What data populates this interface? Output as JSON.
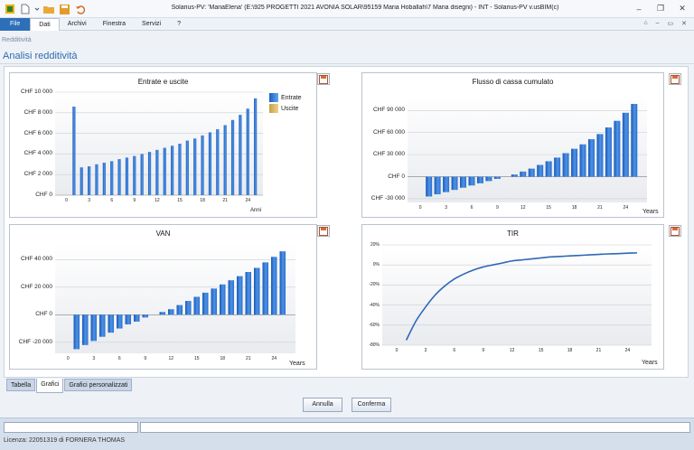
{
  "window": {
    "title": "Solarius-PV: 'MariaElena' (E:\\925 PROGETTI 2021 AVONIA SOLAR\\95159 Maria Hoballah\\7 Maria disegni) - INT - Solarius-PV  v.usBIM(c)"
  },
  "menu": {
    "items": [
      "File",
      "Dati",
      "Archivi",
      "Finestra",
      "Servizi",
      "?"
    ]
  },
  "breadcrumb": "Redditività",
  "page_title": "Analisi redditività",
  "charts": {
    "entrate": {
      "title": "Entrate e uscite",
      "ylabels": [
        "CHF 10 000",
        "CHF 8 000",
        "CHF 6 000",
        "CHF 4 000",
        "CHF 2 000",
        "CHF 0"
      ],
      "xlabels": [
        "0",
        "3",
        "6",
        "9",
        "12",
        "15",
        "18",
        "21",
        "24"
      ],
      "xaxis": "Anni",
      "legend": [
        "Entrate",
        "Uscite"
      ]
    },
    "flusso": {
      "title": "Flusso di cassa cumulato",
      "ylabels": [
        "CHF 90 000",
        "CHF 60 000",
        "CHF 30 000",
        "CHF 0",
        "CHF -30 000"
      ],
      "xlabels": [
        "0",
        "3",
        "6",
        "9",
        "12",
        "15",
        "18",
        "21",
        "24"
      ],
      "xaxis": "Years"
    },
    "van": {
      "title": "VAN",
      "ylabels": [
        "CHF 40 000",
        "CHF 20 000",
        "CHF 0",
        "CHF -20 000"
      ],
      "xlabels": [
        "0",
        "3",
        "6",
        "9",
        "12",
        "15",
        "18",
        "21",
        "24"
      ],
      "xaxis": "Years"
    },
    "tir": {
      "title": "TIR",
      "ylabels": [
        "20%",
        "0%",
        "-20%",
        "-40%",
        "-60%",
        "-80%"
      ],
      "xlabels": [
        "0",
        "3",
        "6",
        "9",
        "12",
        "15",
        "18",
        "21",
        "24"
      ],
      "xaxis": "Years"
    }
  },
  "tabs": [
    "Tabella",
    "Grafici",
    "Grafici personalizzati"
  ],
  "buttons": {
    "annulla": "Annulla",
    "conferma": "Conferma"
  },
  "status": {
    "license": "Licenza: 22051319 di FORNERA THOMAS"
  },
  "colors": {
    "accent": "#2c6cb0",
    "bar": "#2f74d0",
    "uscite": "#d9b45a"
  },
  "chart_data": [
    {
      "type": "bar",
      "title": "Entrate e uscite",
      "xlabel": "Anni",
      "ylabel": "",
      "ylim": [
        0,
        10000
      ],
      "x": [
        1,
        2,
        3,
        4,
        5,
        6,
        7,
        8,
        9,
        10,
        11,
        12,
        13,
        14,
        15,
        16,
        17,
        18,
        19,
        20,
        21,
        22,
        23,
        24,
        25
      ],
      "series": [
        {
          "name": "Entrate",
          "values": [
            8600,
            2700,
            2800,
            3000,
            3150,
            3300,
            3500,
            3650,
            3800,
            4000,
            4200,
            4400,
            4600,
            4800,
            5000,
            5300,
            5500,
            5800,
            6100,
            6400,
            6800,
            7300,
            7800,
            8400,
            9400
          ]
        },
        {
          "name": "Uscite",
          "values": [
            0,
            0,
            0,
            0,
            0,
            0,
            0,
            0,
            0,
            0,
            0,
            0,
            0,
            0,
            0,
            0,
            0,
            0,
            0,
            0,
            0,
            0,
            0,
            0,
            0
          ]
        }
      ],
      "legend_position": "right"
    },
    {
      "type": "bar",
      "title": "Flusso di cassa cumulato",
      "xlabel": "Years",
      "ylabel": "",
      "ylim": [
        -30000,
        110000
      ],
      "x": [
        1,
        2,
        3,
        4,
        5,
        6,
        7,
        8,
        9,
        10,
        11,
        12,
        13,
        14,
        15,
        16,
        17,
        18,
        19,
        20,
        21,
        22,
        23,
        24,
        25
      ],
      "series": [
        {
          "values": [
            -27000,
            -24000,
            -21000,
            -18000,
            -15000,
            -12000,
            -9000,
            -6000,
            -3000,
            0,
            3000,
            7000,
            11000,
            16000,
            21000,
            26000,
            32000,
            38000,
            44000,
            51000,
            58000,
            67000,
            76000,
            87000,
            99000
          ]
        }
      ]
    },
    {
      "type": "bar",
      "title": "VAN",
      "xlabel": "Years",
      "ylabel": "",
      "ylim": [
        -30000,
        50000
      ],
      "x": [
        1,
        2,
        3,
        4,
        5,
        6,
        7,
        8,
        9,
        10,
        11,
        12,
        13,
        14,
        15,
        16,
        17,
        18,
        19,
        20,
        21,
        22,
        23,
        24,
        25
      ],
      "series": [
        {
          "values": [
            -25000,
            -22000,
            -19000,
            -16000,
            -13000,
            -10000,
            -7000,
            -5000,
            -2000,
            0,
            2000,
            4000,
            7000,
            10000,
            13000,
            16000,
            19000,
            22000,
            25000,
            28000,
            31000,
            34000,
            38000,
            42000,
            46000
          ]
        }
      ]
    },
    {
      "type": "line",
      "title": "TIR",
      "xlabel": "Years",
      "ylabel": "",
      "ylim": [
        -80,
        20
      ],
      "x": [
        1,
        2,
        3,
        4,
        5,
        6,
        7,
        8,
        9,
        10,
        11,
        12,
        13,
        14,
        15,
        16,
        17,
        18,
        19,
        20,
        21,
        22,
        23,
        24,
        25
      ],
      "series": [
        {
          "values": [
            -75,
            -56,
            -42,
            -30,
            -21,
            -14,
            -9,
            -5,
            -2,
            0,
            2,
            4,
            5,
            6,
            7,
            8,
            8.5,
            9,
            9.5,
            10,
            10.5,
            11,
            11.3,
            11.7,
            12
          ]
        }
      ]
    }
  ]
}
